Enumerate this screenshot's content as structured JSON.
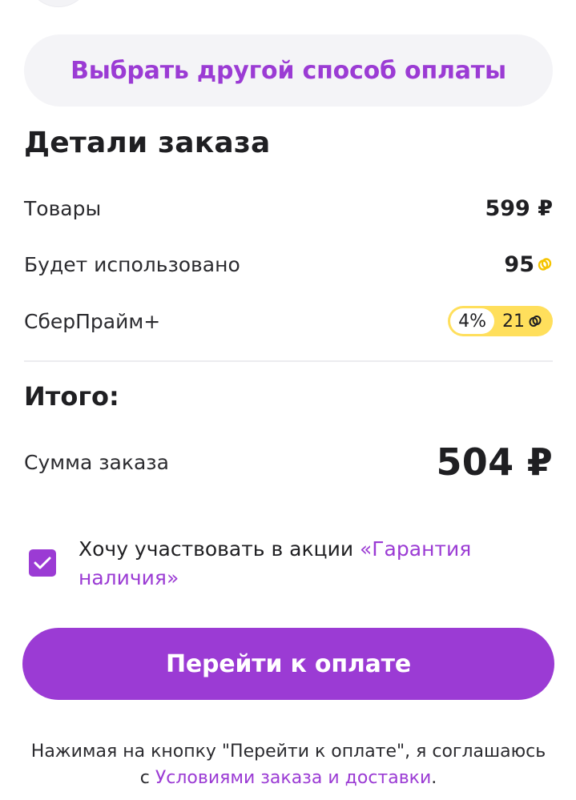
{
  "alt_payment": {
    "label": "Выбрать другой способ оплаты"
  },
  "order_details": {
    "title": "Детали заказа",
    "rows": [
      {
        "label": "Товары",
        "value": "599 ₽"
      },
      {
        "label": "Будет использовано",
        "value": "95"
      },
      {
        "label": "СберПрайм+",
        "percent": "4%",
        "bonus": "21"
      }
    ]
  },
  "total": {
    "title": "Итого:",
    "label": "Сумма заказа",
    "value": "504 ₽"
  },
  "promo": {
    "checked": true,
    "text": "Хочу участвовать в акции ",
    "link": "«Гарантия наличия»"
  },
  "pay_button": {
    "label": "Перейти к оплате"
  },
  "agreement": {
    "text_before": "Нажимая на кнопку \"Перейти к оплате\", я соглашаюсь с ",
    "link": "Условиями заказа и доставки",
    "text_after": "."
  },
  "colors": {
    "accent": "#9b3bd4",
    "bonus_yellow": "#ffdf5c",
    "text": "#1f1f22"
  },
  "icons": {
    "bonus": "bonus-coin-icon",
    "check": "checkmark-icon"
  }
}
